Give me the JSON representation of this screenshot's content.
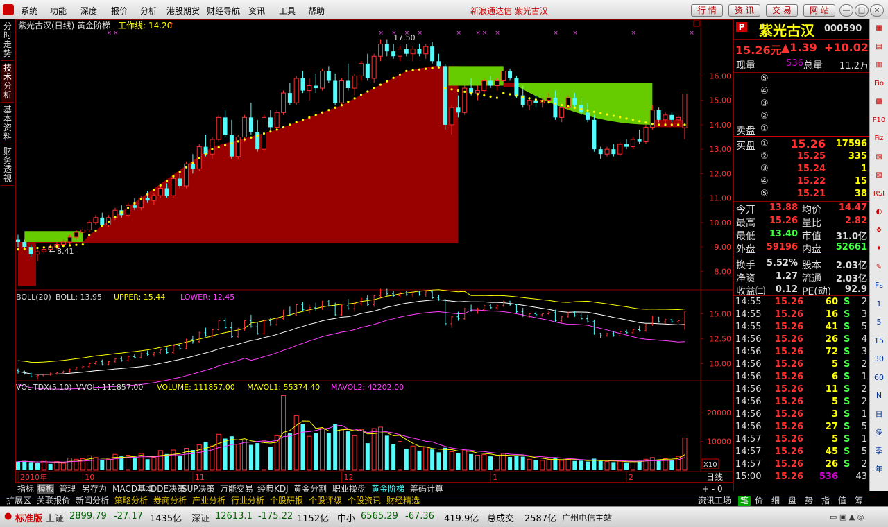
{
  "menus": [
    "系统",
    "功能",
    "深度",
    "报价",
    "分析",
    "港股期货",
    "财经导航",
    "资讯",
    "工具",
    "帮助"
  ],
  "brand": "新浪通达信  紫光古汉",
  "top_buttons": [
    "行 情",
    "资 讯",
    "交 易",
    "网 站"
  ],
  "window_buttons": [
    "—",
    "□",
    "×"
  ],
  "left_tabs": [
    "分时走势",
    "技术分析",
    "基本资料",
    "财务透视"
  ],
  "main": {
    "title": "紫光古汉(日线) 黄金阶梯",
    "work_line_label": "工作线:",
    "work_line_value": "14.20",
    "high_label": "17.50",
    "low_label": "8.41"
  },
  "boll": {
    "name": "BOLL(20)",
    "boll": "BOLL: 13.95",
    "upper": "UPPER: 15.44",
    "lower": "LOWER: 12.45"
  },
  "vol": {
    "name": "VOL-TDX(5,10)",
    "vvol": "VVOL: 111857.00",
    "volume": "VOLUME: 111857.00",
    "mavol1": "MAVOL1: 55374.40",
    "mavol2": "MAVOL2: 42202.00",
    "unit": "X10"
  },
  "price_axis": [
    "16.00",
    "15.00",
    "14.00",
    "13.00",
    "12.00",
    "11.00",
    "10.00",
    "9.00",
    "8.00"
  ],
  "boll_axis": [
    "15.00",
    "12.50",
    "10.00"
  ],
  "vol_axis": [
    "20000",
    "10000"
  ],
  "date_axis": [
    "2010年",
    "10",
    "11",
    "12",
    "1",
    "2"
  ],
  "period": "日线",
  "colors": {
    "up": "#ff3232",
    "down": "#54fcfc",
    "fill_red": "#990000",
    "fill_green": "#66cc00",
    "dot": "#ffff00"
  },
  "quote": {
    "code_badge": "P",
    "name": "紫光古汉",
    "code": "000590",
    "price": "15.26元",
    "change": "▲1.39",
    "change_pct": "+10.02",
    "now_vol_label": "现量",
    "now_vol": "536",
    "total_vol_label": "总量",
    "total_vol": "11.2万",
    "sell_label": "卖盘",
    "sell_levels": [
      "⑤",
      "④",
      "③",
      "②",
      "①"
    ],
    "buy_label": "买盘",
    "buy_levels": [
      {
        "lv": "①",
        "price": "15.26",
        "vol": "17596"
      },
      {
        "lv": "②",
        "price": "15.25",
        "vol": "335"
      },
      {
        "lv": "③",
        "price": "15.24",
        "vol": "1"
      },
      {
        "lv": "④",
        "price": "15.22",
        "vol": "15"
      },
      {
        "lv": "⑤",
        "price": "15.21",
        "vol": "38"
      }
    ],
    "stats": [
      [
        "今开",
        "13.88",
        "均价",
        "14.47"
      ],
      [
        "最高",
        "15.26",
        "量比",
        "2.82"
      ],
      [
        "最低",
        "13.40",
        "市值",
        "31.0亿"
      ],
      [
        "外盘",
        "59196",
        "内盘",
        "52661"
      ],
      [
        "换手",
        "5.52%",
        "股本",
        "2.03亿"
      ],
      [
        "净资",
        "1.27",
        "流通",
        "2.03亿"
      ],
      [
        "收益㈢",
        "0.12",
        "PE(动)",
        "92.9"
      ]
    ]
  },
  "ticks": [
    [
      "14:55",
      "15.26",
      "60",
      "S",
      "2"
    ],
    [
      "14:55",
      "15.26",
      "16",
      "S",
      "3"
    ],
    [
      "14:55",
      "15.26",
      "41",
      "S",
      "5"
    ],
    [
      "14:56",
      "15.26",
      "26",
      "S",
      "4"
    ],
    [
      "14:56",
      "15.26",
      "72",
      "S",
      "3"
    ],
    [
      "14:56",
      "15.26",
      "5",
      "S",
      "2"
    ],
    [
      "14:56",
      "15.26",
      "6",
      "S",
      "1"
    ],
    [
      "14:56",
      "15.26",
      "11",
      "S",
      "2"
    ],
    [
      "14:56",
      "15.26",
      "5",
      "S",
      "2"
    ],
    [
      "14:56",
      "15.26",
      "3",
      "S",
      "1"
    ],
    [
      "14:56",
      "15.26",
      "27",
      "S",
      "5"
    ],
    [
      "14:57",
      "15.26",
      "5",
      "S",
      "1"
    ],
    [
      "14:57",
      "15.26",
      "45",
      "S",
      "5"
    ],
    [
      "14:57",
      "15.26",
      "26",
      "S",
      "2"
    ],
    [
      "15:00",
      "15.26",
      "536",
      "",
      "43"
    ]
  ],
  "right_icons": [
    "▦",
    "▤",
    "▥",
    "Fio",
    "▩",
    "F10",
    "Fiz",
    "▧",
    "▨",
    "RSI",
    "◐",
    "✥",
    "✦",
    "✎",
    "Fs",
    "1",
    "5",
    "15",
    "30",
    "60",
    "N",
    "日",
    "多",
    "季",
    "年"
  ],
  "tabs_row1": [
    "指标",
    "模板",
    "管理",
    "另存为",
    "MACD基本",
    "DDE决策",
    "SUP决策",
    "万能交易",
    "经典KDJ",
    "黄金分割",
    "职业操盘",
    "黄金阶梯",
    "筹码计算"
  ],
  "tabs_row1_active": "黄金阶梯",
  "tabs_row2": [
    "扩展区",
    "关联报价",
    "新闻分析",
    "策略分析",
    "券商分析",
    "产业分析",
    "行业分析",
    "个股研报",
    "个股评级",
    "个股资讯",
    "财经精选"
  ],
  "tabs_row2_right": "资讯工场",
  "bottom_tabs": [
    "笔",
    "价",
    "细",
    "盘",
    "势",
    "指",
    "值",
    "筹"
  ],
  "status": {
    "edition": "标准版",
    "sh_label": "上证",
    "sh": "2899.79",
    "sh_chg": "-27.17",
    "sh_amt": "1435亿",
    "sz_label": "深证",
    "sz": "12613.1",
    "sz_chg": "-175.22",
    "sz_amt": "1152亿",
    "zx_label": "中小",
    "zx": "6565.29",
    "zx_chg": "-67.36",
    "zx_amt": "419.9亿",
    "total_label": "总成交",
    "total": "2587亿",
    "server": "广州电信主站"
  },
  "chart_data": {
    "type": "candlestick",
    "candles": [
      [
        9.3,
        9.5,
        9.0,
        9.2
      ],
      [
        9.2,
        9.3,
        8.9,
        9.0
      ],
      [
        9.0,
        9.1,
        8.6,
        8.7
      ],
      [
        8.7,
        8.9,
        8.41,
        8.8
      ],
      [
        8.8,
        9.0,
        8.7,
        8.9
      ],
      [
        8.9,
        9.1,
        8.8,
        9.0
      ],
      [
        9.0,
        9.2,
        8.9,
        9.1
      ],
      [
        9.1,
        9.3,
        9.0,
        9.2
      ],
      [
        9.2,
        9.5,
        9.1,
        9.4
      ],
      [
        9.4,
        9.7,
        9.3,
        9.6
      ],
      [
        9.6,
        9.8,
        9.5,
        9.7
      ],
      [
        9.7,
        10.1,
        9.6,
        10.0
      ],
      [
        10.0,
        10.3,
        9.9,
        10.2
      ],
      [
        10.2,
        10.4,
        9.8,
        9.9
      ],
      [
        9.9,
        10.3,
        9.8,
        10.2
      ],
      [
        10.2,
        10.6,
        10.1,
        10.5
      ],
      [
        10.5,
        10.7,
        10.2,
        10.3
      ],
      [
        10.3,
        10.8,
        10.2,
        10.7
      ],
      [
        10.7,
        11.0,
        10.5,
        10.6
      ],
      [
        10.6,
        11.1,
        10.5,
        11.0
      ],
      [
        11.0,
        11.3,
        10.8,
        10.9
      ],
      [
        10.9,
        11.2,
        10.7,
        11.1
      ],
      [
        11.1,
        11.5,
        11.0,
        11.4
      ],
      [
        11.4,
        11.6,
        11.0,
        11.1
      ],
      [
        11.1,
        11.9,
        11.0,
        11.8
      ],
      [
        11.8,
        12.0,
        11.4,
        11.5
      ],
      [
        11.5,
        12.5,
        11.4,
        12.4
      ],
      [
        12.4,
        12.8,
        12.0,
        12.2
      ],
      [
        12.2,
        13.2,
        12.1,
        13.1
      ],
      [
        13.1,
        13.6,
        12.7,
        12.8
      ],
      [
        12.8,
        13.5,
        12.6,
        13.4
      ],
      [
        13.4,
        14.4,
        13.3,
        14.3
      ],
      [
        14.3,
        14.6,
        13.5,
        13.6
      ],
      [
        13.6,
        14.2,
        12.6,
        12.7
      ],
      [
        12.7,
        13.6,
        12.6,
        13.5
      ],
      [
        13.5,
        14.4,
        13.3,
        14.3
      ],
      [
        14.3,
        14.9,
        13.6,
        13.7
      ],
      [
        13.7,
        14.2,
        12.9,
        13.0
      ],
      [
        13.0,
        14.4,
        12.9,
        14.3
      ],
      [
        14.3,
        14.6,
        13.8,
        13.9
      ],
      [
        13.9,
        14.6,
        13.8,
        14.5
      ],
      [
        14.5,
        15.4,
        14.4,
        15.3
      ],
      [
        15.3,
        15.7,
        14.8,
        14.9
      ],
      [
        14.9,
        16.0,
        14.8,
        15.9
      ],
      [
        15.9,
        16.2,
        15.3,
        15.4
      ],
      [
        15.4,
        15.9,
        15.0,
        15.6
      ],
      [
        15.6,
        16.1,
        15.3,
        15.5
      ],
      [
        15.5,
        16.3,
        15.4,
        16.2
      ],
      [
        16.2,
        16.4,
        15.7,
        15.8
      ],
      [
        15.8,
        16.1,
        14.8,
        14.9
      ],
      [
        14.9,
        15.9,
        14.8,
        15.8
      ],
      [
        15.8,
        16.5,
        15.4,
        15.5
      ],
      [
        15.5,
        16.1,
        15.2,
        16.0
      ],
      [
        16.0,
        16.6,
        15.8,
        16.5
      ],
      [
        16.5,
        16.9,
        15.8,
        15.9
      ],
      [
        15.9,
        16.9,
        15.7,
        16.8
      ],
      [
        16.8,
        17.5,
        16.6,
        17.3
      ],
      [
        17.3,
        17.5,
        16.8,
        17.0
      ],
      [
        17.0,
        17.3,
        16.7,
        16.8
      ],
      [
        16.8,
        17.2,
        16.6,
        17.1
      ],
      [
        17.1,
        17.3,
        16.8,
        16.9
      ],
      [
        16.9,
        17.2,
        16.6,
        17.1
      ],
      [
        17.1,
        17.3,
        16.8,
        16.9
      ],
      [
        16.9,
        17.3,
        16.7,
        17.2
      ],
      [
        17.2,
        17.4,
        16.5,
        16.6
      ],
      [
        16.6,
        16.9,
        16.3,
        16.4
      ],
      [
        16.4,
        16.5,
        13.8,
        14.0
      ],
      [
        14.0,
        14.8,
        13.6,
        14.7
      ],
      [
        14.7,
        15.2,
        14.3,
        14.5
      ],
      [
        14.5,
        15.6,
        14.4,
        15.5
      ],
      [
        15.5,
        15.9,
        15.2,
        15.3
      ],
      [
        15.3,
        15.6,
        15.0,
        15.4
      ],
      [
        15.4,
        15.9,
        15.2,
        15.8
      ],
      [
        15.8,
        16.0,
        15.5,
        15.6
      ],
      [
        15.6,
        15.9,
        15.4,
        15.8
      ],
      [
        15.8,
        16.3,
        15.7,
        16.2
      ],
      [
        16.2,
        16.3,
        15.8,
        15.9
      ],
      [
        15.9,
        16.0,
        15.1,
        15.2
      ],
      [
        15.2,
        15.6,
        14.7,
        14.8
      ],
      [
        14.8,
        15.1,
        14.6,
        15.0
      ],
      [
        15.0,
        15.2,
        14.7,
        14.9
      ],
      [
        14.9,
        15.1,
        14.7,
        15.0
      ],
      [
        15.0,
        15.3,
        14.9,
        15.1
      ],
      [
        15.1,
        15.4,
        14.2,
        14.3
      ],
      [
        14.3,
        14.8,
        14.1,
        14.7
      ],
      [
        14.7,
        15.2,
        14.6,
        15.1
      ],
      [
        15.1,
        15.3,
        14.7,
        14.8
      ],
      [
        14.8,
        15.1,
        14.4,
        14.5
      ],
      [
        14.5,
        14.9,
        14.1,
        14.2
      ],
      [
        14.2,
        14.4,
        12.9,
        13.0
      ],
      [
        13.0,
        13.1,
        12.6,
        12.8
      ],
      [
        12.8,
        13.1,
        12.7,
        13.0
      ],
      [
        13.0,
        13.2,
        12.7,
        12.8
      ],
      [
        12.8,
        13.3,
        12.7,
        13.2
      ],
      [
        13.2,
        13.4,
        13.0,
        13.1
      ],
      [
        13.1,
        13.5,
        13.0,
        13.4
      ],
      [
        13.4,
        13.8,
        13.2,
        13.3
      ],
      [
        13.3,
        14.0,
        13.2,
        13.9
      ],
      [
        13.9,
        14.8,
        13.8,
        14.6
      ],
      [
        14.6,
        14.7,
        14.1,
        14.2
      ],
      [
        14.2,
        14.5,
        14.0,
        14.4
      ],
      [
        14.4,
        14.5,
        14.1,
        14.2
      ],
      [
        14.2,
        14.4,
        14.0,
        14.3
      ],
      [
        13.88,
        15.26,
        13.4,
        15.26
      ]
    ],
    "stair_line": [
      [
        0,
        9.2
      ],
      [
        10,
        9.2
      ],
      [
        10.5,
        9.3
      ],
      [
        30,
        13.1
      ],
      [
        40,
        13.8
      ],
      [
        50,
        14.8
      ],
      [
        60,
        16.2
      ],
      [
        63,
        16.4
      ],
      [
        66,
        16.4
      ],
      [
        66.5,
        16.1
      ],
      [
        75,
        15.6
      ],
      [
        85,
        15.0
      ],
      [
        95,
        14.0
      ],
      [
        98,
        14.0
      ],
      [
        100,
        14.2
      ],
      [
        103,
        14.2
      ]
    ],
    "volumes": [
      [
        3000,
        "d"
      ],
      [
        3200,
        "d"
      ],
      [
        2800,
        "d"
      ],
      [
        2500,
        "d"
      ],
      [
        3500,
        "u"
      ],
      [
        2200,
        "d"
      ],
      [
        3000,
        "u"
      ],
      [
        2400,
        "u"
      ],
      [
        4200,
        "u"
      ],
      [
        3800,
        "u"
      ],
      [
        4000,
        "u"
      ],
      [
        5000,
        "u"
      ],
      [
        4400,
        "u"
      ],
      [
        3500,
        "d"
      ],
      [
        3800,
        "u"
      ],
      [
        5500,
        "u"
      ],
      [
        4800,
        "d"
      ],
      [
        5200,
        "u"
      ],
      [
        4600,
        "d"
      ],
      [
        5800,
        "u"
      ],
      [
        3800,
        "d"
      ],
      [
        4400,
        "u"
      ],
      [
        6800,
        "u"
      ],
      [
        5600,
        "d"
      ],
      [
        7000,
        "u"
      ],
      [
        5000,
        "d"
      ],
      [
        7600,
        "u"
      ],
      [
        7000,
        "d"
      ],
      [
        8800,
        "u"
      ],
      [
        9800,
        "d"
      ],
      [
        8400,
        "u"
      ],
      [
        12500,
        "u"
      ],
      [
        11000,
        "d"
      ],
      [
        11800,
        "d"
      ],
      [
        9000,
        "u"
      ],
      [
        10500,
        "u"
      ],
      [
        8800,
        "d"
      ],
      [
        9400,
        "d"
      ],
      [
        10200,
        "u"
      ],
      [
        8200,
        "d"
      ],
      [
        12000,
        "u"
      ],
      [
        26000,
        "u"
      ],
      [
        12800,
        "d"
      ],
      [
        19000,
        "u"
      ],
      [
        16000,
        "d"
      ],
      [
        11800,
        "u"
      ],
      [
        13000,
        "d"
      ],
      [
        14500,
        "u"
      ],
      [
        13000,
        "d"
      ],
      [
        16000,
        "d"
      ],
      [
        14000,
        "u"
      ],
      [
        13500,
        "d"
      ],
      [
        12000,
        "u"
      ],
      [
        14200,
        "u"
      ],
      [
        9400,
        "d"
      ],
      [
        14500,
        "u"
      ],
      [
        15000,
        "u"
      ],
      [
        12000,
        "d"
      ],
      [
        9000,
        "d"
      ],
      [
        10000,
        "u"
      ],
      [
        7400,
        "d"
      ],
      [
        8400,
        "u"
      ],
      [
        6800,
        "d"
      ],
      [
        8000,
        "u"
      ],
      [
        7200,
        "d"
      ],
      [
        6200,
        "d"
      ],
      [
        7800,
        "d"
      ],
      [
        6400,
        "u"
      ],
      [
        5800,
        "d"
      ],
      [
        7000,
        "u"
      ],
      [
        5600,
        "d"
      ],
      [
        5200,
        "u"
      ],
      [
        5400,
        "u"
      ],
      [
        4800,
        "d"
      ],
      [
        5000,
        "u"
      ],
      [
        5800,
        "u"
      ],
      [
        4600,
        "d"
      ],
      [
        5200,
        "d"
      ],
      [
        4700,
        "d"
      ],
      [
        3800,
        "u"
      ],
      [
        3600,
        "d"
      ],
      [
        3400,
        "u"
      ],
      [
        3600,
        "u"
      ],
      [
        4200,
        "d"
      ],
      [
        3400,
        "u"
      ],
      [
        3800,
        "u"
      ],
      [
        3200,
        "d"
      ],
      [
        3300,
        "d"
      ],
      [
        3000,
        "d"
      ],
      [
        4000,
        "d"
      ],
      [
        3200,
        "d"
      ],
      [
        3000,
        "u"
      ],
      [
        2800,
        "d"
      ],
      [
        3100,
        "u"
      ],
      [
        2700,
        "d"
      ],
      [
        3000,
        "u"
      ],
      [
        3300,
        "d"
      ],
      [
        3800,
        "u"
      ],
      [
        4400,
        "u"
      ],
      [
        3600,
        "d"
      ],
      [
        4000,
        "u"
      ],
      [
        3400,
        "d"
      ],
      [
        4800,
        "u"
      ],
      [
        11186,
        "u"
      ]
    ],
    "boll_upper_ylim": [
      8.5,
      16.7
    ],
    "price_ylim": [
      7.3,
      17.8
    ],
    "vol_ylim": [
      0,
      29000
    ]
  }
}
